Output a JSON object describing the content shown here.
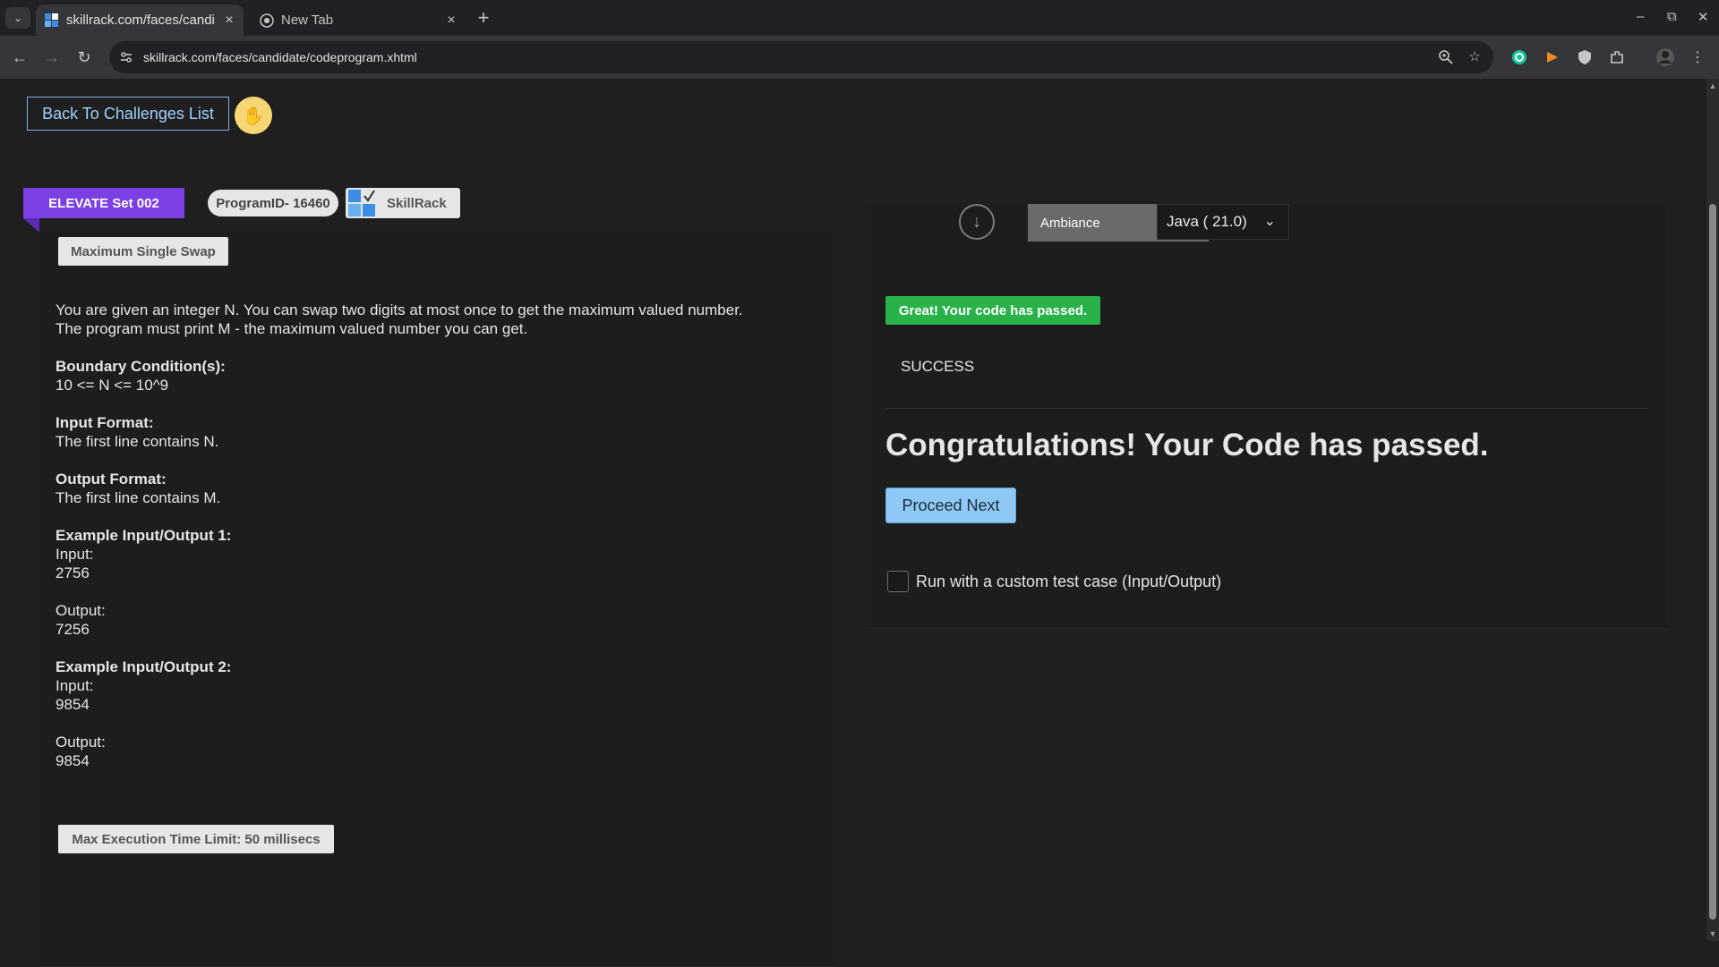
{
  "browser": {
    "tabs": [
      {
        "title": "skillrack.com/faces/candi",
        "close": "×"
      },
      {
        "title": "New Tab",
        "close": "×"
      }
    ],
    "new_tab": "+",
    "url": "skillrack.com/faces/candidate/codeprogram.xhtml",
    "window_controls": {
      "minimize": "–",
      "maximize": "⧉",
      "close": "✕"
    },
    "nav": {
      "back": "←",
      "forward": "→",
      "reload": "↻"
    }
  },
  "page": {
    "back_label": "Back To Challenges List",
    "set_label": "ELEVATE Set 002",
    "program_id": "ProgramID- 16460",
    "brand": "SkillRack",
    "problem_title": "Maximum Single Swap",
    "description_line1": "You are given an integer N. You can swap two digits at most once to get the maximum valued number.",
    "description_line2": "The program must print M - the maximum valued number you can get.",
    "boundary_heading": "Boundary Condition(s):",
    "boundary_value": "10 <= N <= 10^9",
    "input_format_heading": "Input Format:",
    "input_format_value": "The first line contains N.",
    "output_format_heading": "Output Format:",
    "output_format_value": "The first line contains M.",
    "examples": [
      {
        "heading": "Example Input/Output 1:",
        "input_label": "Input:",
        "input": "2756",
        "output_label": "Output:",
        "output": "7256"
      },
      {
        "heading": "Example Input/Output 2:",
        "input_label": "Input:",
        "input": "9854",
        "output_label": "Output:",
        "output": "9854"
      }
    ],
    "time_limit": "Max Execution Time Limit: 50 millisecs"
  },
  "result": {
    "ambiance_label": "Ambiance",
    "language": "Java ( 21.0)",
    "pass_badge": "Great! Your code has passed.",
    "status": "SUCCESS",
    "congrats": "Congratulations! Your Code has passed.",
    "proceed_label": "Proceed Next",
    "custom_test_label": "Run with a custom test case (Input/Output)"
  },
  "colors": {
    "ribbon": "#7b3fe4",
    "pass": "#29b24a",
    "proceed": "#8ec9f5",
    "hand": "#f7d774"
  }
}
